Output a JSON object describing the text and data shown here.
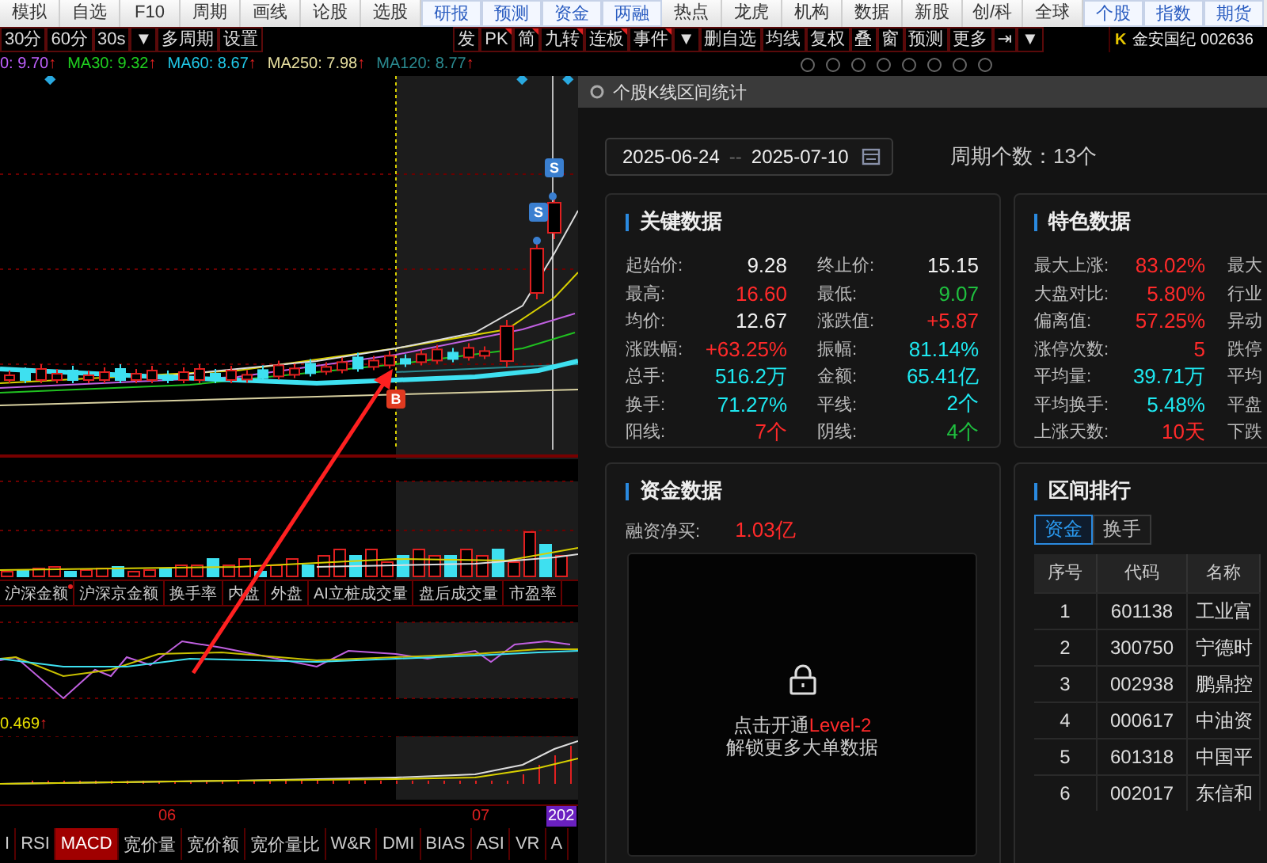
{
  "top_menu": [
    {
      "label": "模拟",
      "kind": "plain"
    },
    {
      "label": "自选",
      "kind": "plain"
    },
    {
      "label": "F10",
      "kind": "plain"
    },
    {
      "label": "周期",
      "kind": "plain"
    },
    {
      "label": "画线",
      "kind": "plain"
    },
    {
      "label": "论股",
      "kind": "plain"
    },
    {
      "label": "选股",
      "kind": "plain"
    },
    {
      "label": "研报",
      "kind": "accent"
    },
    {
      "label": "预测",
      "kind": "accent"
    },
    {
      "label": "资金",
      "kind": "accent"
    },
    {
      "label": "两融",
      "kind": "accent"
    },
    {
      "label": "热点",
      "kind": "plain"
    },
    {
      "label": "龙虎",
      "kind": "plain"
    },
    {
      "label": "机构",
      "kind": "plain"
    },
    {
      "label": "数据",
      "kind": "plain"
    },
    {
      "label": "新股",
      "kind": "plain"
    },
    {
      "label": "创/科",
      "kind": "plain"
    },
    {
      "label": "全球",
      "kind": "plain"
    },
    {
      "label": "个股",
      "kind": "accent"
    },
    {
      "label": "指数",
      "kind": "accent"
    },
    {
      "label": "期货",
      "kind": "accent"
    }
  ],
  "toolbar": {
    "left": [
      {
        "label": "30分",
        "flagged": false
      },
      {
        "label": "60分",
        "flagged": false
      },
      {
        "label": "30s",
        "flagged": false
      },
      {
        "label": "▼",
        "flagged": false
      },
      {
        "label": "多周期",
        "flagged": false
      },
      {
        "label": "设置",
        "flagged": false
      }
    ],
    "right": [
      {
        "label": "发",
        "flagged": false
      },
      {
        "label": "PK",
        "flagged": true
      },
      {
        "label": "简",
        "flagged": true
      },
      {
        "label": "九转",
        "flagged": true
      },
      {
        "label": "连板",
        "flagged": true
      },
      {
        "label": "事件",
        "flagged": true
      },
      {
        "label": "▼",
        "flagged": false
      },
      {
        "label": "删自选",
        "flagged": false
      },
      {
        "label": "均线",
        "flagged": false
      },
      {
        "label": "复权",
        "flagged": false
      },
      {
        "label": "叠",
        "flagged": false
      },
      {
        "label": "窗",
        "flagged": false
      },
      {
        "label": "预测",
        "flagged": false
      },
      {
        "label": "更多",
        "flagged": false
      },
      {
        "label": "⇥",
        "flagged": false
      },
      {
        "label": "▼",
        "flagged": false
      }
    ]
  },
  "stock_header": {
    "badge": "K",
    "title": "金安国纪 002636"
  },
  "ma_legend": [
    {
      "label": "0: 9.70",
      "arrow": "↑",
      "color": "#c060ff"
    },
    {
      "label": "MA30: 9.32",
      "arrow": "↑",
      "color": "#20d020"
    },
    {
      "label": "MA60: 8.67",
      "arrow": "↑",
      "color": "#20c8e8"
    },
    {
      "label": "MA250: 7.98",
      "arrow": "↑",
      "color": "#e8e0a0"
    },
    {
      "label": "MA120: 8.77",
      "arrow": "↑",
      "color": "#2a8a90"
    }
  ],
  "chart_signals": [
    {
      "label": "S",
      "kind": "sell"
    },
    {
      "label": "S",
      "kind": "sell"
    },
    {
      "label": "B",
      "kind": "buy"
    }
  ],
  "indicator_tabs": [
    {
      "label": "沪深金额",
      "flagged": true
    },
    {
      "label": "沪深京金额",
      "flagged": false
    },
    {
      "label": "换手率",
      "flagged": false
    },
    {
      "label": "内盘",
      "flagged": false
    },
    {
      "label": "外盘",
      "flagged": false
    },
    {
      "label": "AI立桩成交量",
      "flagged": false
    },
    {
      "label": "盘后成交量",
      "flagged": false
    },
    {
      "label": "市盈率",
      "flagged": false
    }
  ],
  "indicator_value": {
    "label": "0.469",
    "arrow": "↑"
  },
  "time_axis": [
    {
      "label": "06",
      "kind": "tick"
    },
    {
      "label": "07",
      "kind": "tick"
    },
    {
      "label": "202",
      "kind": "cursor"
    }
  ],
  "bottom_tabs": [
    {
      "label": "I",
      "selected": false
    },
    {
      "label": "RSI",
      "selected": false
    },
    {
      "label": "MACD",
      "selected": true
    },
    {
      "label": "宽价量",
      "selected": false
    },
    {
      "label": "宽价额",
      "selected": false
    },
    {
      "label": "宽价量比",
      "selected": false
    },
    {
      "label": "W&R",
      "selected": false
    },
    {
      "label": "DMI",
      "selected": false
    },
    {
      "label": "BIAS",
      "selected": false
    },
    {
      "label": "ASI",
      "selected": false
    },
    {
      "label": "VR",
      "selected": false
    },
    {
      "label": "A",
      "selected": false
    }
  ],
  "dialog": {
    "title": "个股K线区间统计",
    "date_from": "2025-06-24",
    "date_separator": "--",
    "date_to": "2025-07-10",
    "period": "周期个数：13个",
    "key_data": {
      "title": "关键数据",
      "items": [
        {
          "label": "起始价:",
          "value": "9.28",
          "color": "#f0f0f0"
        },
        {
          "label": "终止价:",
          "value": "15.15",
          "color": "#f0f0f0"
        },
        {
          "label": "最高:",
          "value": "16.60",
          "color": "#ff2a2a"
        },
        {
          "label": "最低:",
          "value": "9.07",
          "color": "#1fbf3f"
        },
        {
          "label": "均价:",
          "value": "12.67",
          "color": "#f0f0f0"
        },
        {
          "label": "涨跌值:",
          "value": "+5.87",
          "color": "#ff2a2a"
        },
        {
          "label": "涨跌幅:",
          "value": "+63.25%",
          "color": "#ff2a2a"
        },
        {
          "label": "振幅:",
          "value": "81.14%",
          "color": "#1ee8f0"
        },
        {
          "label": "总手:",
          "value": "516.2万",
          "color": "#1ee8f0"
        },
        {
          "label": "金额:",
          "value": "65.41亿",
          "color": "#1ee8f0"
        },
        {
          "label": "换手:",
          "value": "71.27%",
          "color": "#1ee8f0"
        },
        {
          "label": "平线:",
          "value": "2个",
          "color": "#1ee8f0"
        },
        {
          "label": "阳线:",
          "value": "7个",
          "color": "#ff2a2a"
        },
        {
          "label": "阴线:",
          "value": "4个",
          "color": "#1fbf3f"
        }
      ]
    },
    "feature_data": {
      "title": "特色数据",
      "items": [
        {
          "label": "最大上涨:",
          "value": "83.02%",
          "color": "#ff2a2a"
        },
        {
          "label": "大盘对比:",
          "value": "5.80%",
          "color": "#ff2a2a"
        },
        {
          "label": "偏离值:",
          "value": "57.25%",
          "color": "#ff2a2a"
        },
        {
          "label": "涨停次数:",
          "value": "5",
          "color": "#ff2a2a"
        },
        {
          "label": "平均量:",
          "value": "39.71万",
          "color": "#1ee8f0"
        },
        {
          "label": "平均换手:",
          "value": "5.48%",
          "color": "#1ee8f0"
        },
        {
          "label": "上涨天数:",
          "value": "10天",
          "color": "#ff2a2a"
        }
      ],
      "column_2_labels": [
        "最大",
        "行业",
        "异动",
        "跌停",
        "平均",
        "平盘",
        "下跌"
      ]
    },
    "fund_data": {
      "title": "资金数据",
      "label": "融资净买:",
      "value": "1.03亿",
      "color": "#ff2a2a",
      "lock_text": "点击开通",
      "lock_link": "Level-2",
      "lock_note": "解锁更多大单数据"
    },
    "ranking": {
      "title": "区间排行",
      "tabs": [
        {
          "label": "资金",
          "selected": true
        },
        {
          "label": "换手",
          "selected": false
        }
      ],
      "columns": [
        "序号",
        "代码",
        "名称"
      ],
      "rows": [
        {
          "rank": "1",
          "code": "601138",
          "name": "工业富"
        },
        {
          "rank": "2",
          "code": "300750",
          "name": "宁德时"
        },
        {
          "rank": "3",
          "code": "002938",
          "name": "鹏鼎控"
        },
        {
          "rank": "4",
          "code": "000617",
          "name": "中油资"
        },
        {
          "rank": "5",
          "code": "601318",
          "name": "中国平"
        },
        {
          "rank": "6",
          "code": "002017",
          "name": "东信和"
        }
      ]
    }
  }
}
